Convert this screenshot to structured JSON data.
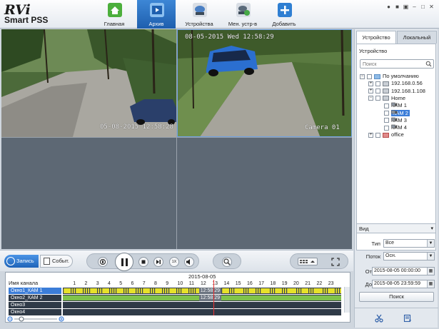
{
  "app": {
    "logo_top": "RVi",
    "logo_bottom": "Smart PSS"
  },
  "nav": [
    {
      "label": "Главная",
      "icon": "home-icon",
      "color": "#4caf3c",
      "active": false
    },
    {
      "label": "Архив",
      "icon": "playback-icon",
      "color": "#5a9bde",
      "active": true
    },
    {
      "label": "Устройства",
      "icon": "devices-icon",
      "color": "#4a7fc4",
      "active": false
    },
    {
      "label": "Мен. устр-в",
      "icon": "device-manager-icon",
      "color": "#46a846",
      "active": false
    },
    {
      "label": "Добавить",
      "icon": "add-icon",
      "color": "#2f7fd2",
      "active": false
    }
  ],
  "window_controls": [
    "settings-icon",
    "lock-icon",
    "fullscreen-icon",
    "minimize-icon",
    "maximize-icon",
    "close-icon"
  ],
  "video": {
    "cam1_osd": "05-08-2015 12:58:28",
    "cam2_osd_date": "08-05-2015 Wed 12:58:29",
    "cam2_osd_name": "Camera 01"
  },
  "right_panel": {
    "tabs": [
      "Устройство",
      "Локальный"
    ],
    "device_title": "Устройство",
    "search_placeholder": "Поиск",
    "tree": [
      {
        "label": "По умолчанию",
        "level": 0,
        "expander": "-",
        "icon": "folder",
        "selected": false
      },
      {
        "label": "192.168.0.56",
        "level": 1,
        "expander": "+",
        "icon": "dvr",
        "selected": false
      },
      {
        "label": "192.168.1.108",
        "level": 1,
        "expander": "+",
        "icon": "dvr",
        "selected": false
      },
      {
        "label": "Home",
        "level": 1,
        "expander": "-",
        "icon": "dvr",
        "selected": false
      },
      {
        "label": "КАМ 1",
        "level": 2,
        "expander": "",
        "icon": "cam",
        "selected": false
      },
      {
        "label": "КАМ 2",
        "level": 2,
        "expander": "",
        "icon": "cam",
        "selected": true
      },
      {
        "label": "КАМ 3",
        "level": 2,
        "expander": "",
        "icon": "cam",
        "selected": false
      },
      {
        "label": "КАМ 4",
        "level": 2,
        "expander": "",
        "icon": "cam",
        "selected": false
      },
      {
        "label": "office",
        "level": 1,
        "expander": "+",
        "icon": "dvrred",
        "selected": false
      }
    ],
    "view_label": "Вид",
    "type_label": "Тип",
    "type_value": "Все",
    "stream_label": "Поток",
    "stream_value": "Осн.",
    "from_label": "От",
    "from_value": "2015-08-05 00:00:00",
    "to_label": "До",
    "to_value": "2015-08-05 23:59:59",
    "search_button": "Поиск"
  },
  "controls": {
    "record_label": "Запись",
    "events_label": "Событ.",
    "speed_label": "1X"
  },
  "timeline": {
    "date": "2015-08-05",
    "channel_header": "Имя канала",
    "hours": [
      "1",
      "2",
      "3",
      "4",
      "5",
      "6",
      "7",
      "8",
      "9",
      "10",
      "11",
      "12",
      "13",
      "14",
      "15",
      "16",
      "17",
      "18",
      "19",
      "20",
      "21",
      "22",
      "23"
    ],
    "channels": [
      {
        "name": "Окно1_КАМ 1",
        "selected": true,
        "time": "12:58:29",
        "recorded": true
      },
      {
        "name": "Окно2_КАМ 2",
        "selected": false,
        "time": "12:58:29",
        "recorded": true
      },
      {
        "name": "Окно3",
        "selected": false,
        "time": "",
        "recorded": false
      },
      {
        "name": "Окно4",
        "selected": false,
        "time": "",
        "recorded": false
      }
    ],
    "playhead_hour": 12.97
  },
  "colors": {
    "accent": "#3b7dd8",
    "record_yellow": "#e6e12a",
    "record_green": "#7fc24a",
    "track_bg": "#2f3a47"
  }
}
